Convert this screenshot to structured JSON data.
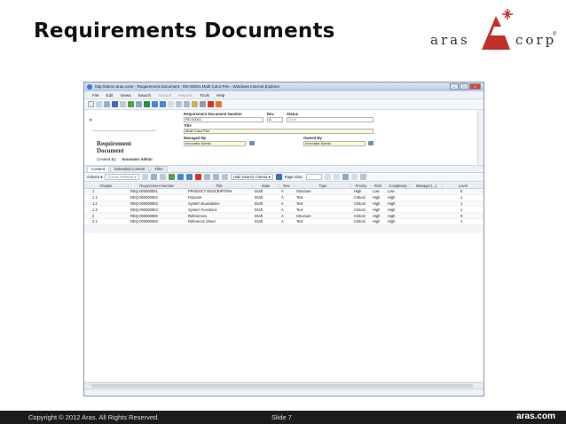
{
  "slide": {
    "title": "Requirements Documents",
    "logo_text_left": "aras",
    "logo_text_right": "corp",
    "logo_reg": "®",
    "footer_left": "Copyright © 2012 Aras.  All Rights Reserved.",
    "footer_mid": "Slide 7",
    "footer_right": "aras.com"
  },
  "browser": {
    "title": "http://demo.aras.com/ - Requirement Document - RD-00001 Multi Color Pen - Windows Internet Explorer",
    "win_minimize": "–",
    "win_maximize": "□",
    "win_close": "x",
    "menu": [
      "File",
      "Edit",
      "Views",
      "Search",
      "Actions",
      "Reports",
      "Tools",
      "Help"
    ]
  },
  "form": {
    "close_glyph": "✕",
    "item_type_title": "Requirement Document",
    "created_by_label": "Created By:",
    "created_by_value": "Innovator Admin",
    "number_label": "Requirement Document Number",
    "number_value": "RD-00001",
    "rev_label": "Rev",
    "rev_value": "A",
    "status_label": "Status",
    "status_value": "Draft",
    "title_label": "Title",
    "title_value": "Multi Color Pen",
    "managed_by_label": "Managed By",
    "managed_by_value": "Innovator Admin",
    "owned_by_label": "Owned By",
    "owned_by_value": "Innovator Admin"
  },
  "tabs": [
    "Content",
    "Extended Content",
    "Files"
  ],
  "gridbar": {
    "actions_label": "Actions ▾",
    "create_related": "Create Related ▾",
    "hide_search": "Hide Search Criteria ▾",
    "page_size": "Page Size:"
  },
  "grid": {
    "columns": [
      "Chapter",
      "Requirement Number",
      "Title",
      "State",
      "Rev",
      "Type",
      "Priority",
      "Risk",
      "Complexity",
      "Manager [...]",
      "Level"
    ],
    "rows": [
      [
        "1",
        "REQ-000000001",
        "PRODUCT DESCRIPTION",
        "Draft",
        "A",
        "Structure",
        "High",
        "Low",
        "Low",
        "",
        "0"
      ],
      [
        "1.1",
        "REQ-000000002",
        "Purpose",
        "Draft",
        "A",
        "Text",
        "Critical",
        "High",
        "High",
        "",
        "1"
      ],
      [
        "1.2",
        "REQ-000000003",
        "System Boundaries",
        "Draft",
        "A",
        "Text",
        "Critical",
        "High",
        "High",
        "",
        "1"
      ],
      [
        "1.3",
        "REQ-000000004",
        "System Functions",
        "Draft",
        "A",
        "Text",
        "Critical",
        "High",
        "High",
        "",
        "1"
      ],
      [
        "2",
        "REQ-000000005",
        "References",
        "Draft",
        "A",
        "Structure",
        "Critical",
        "High",
        "High",
        "",
        "0"
      ],
      [
        "2.1",
        "REQ-000000006",
        "Reference Sheet",
        "Draft",
        "A",
        "Text",
        "Critical",
        "High",
        "High",
        "",
        "1"
      ]
    ]
  },
  "colors": {
    "logo_red": "#c0312b",
    "footer_bg": "#1c1c1c",
    "field_yellow": "#fdf9d4"
  }
}
